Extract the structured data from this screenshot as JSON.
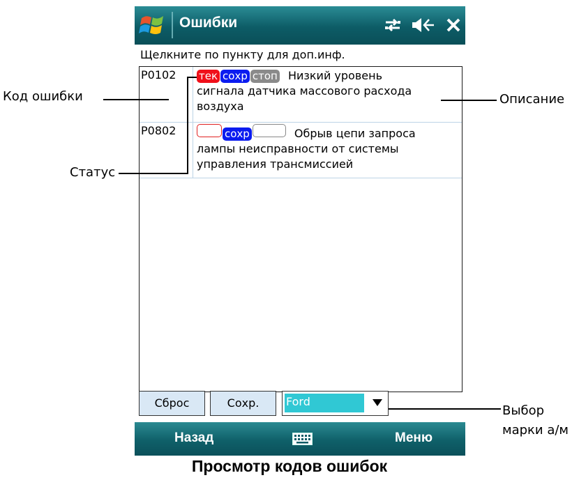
{
  "window": {
    "title": "Ошибки",
    "status_icons": [
      "sync-icon",
      "volume-icon",
      "close-icon"
    ]
  },
  "hint": "Щелкните по пункту для доп.инф.",
  "faults": [
    {
      "code": "P0102",
      "badges": [
        "тек",
        "сохр",
        "стоп"
      ],
      "description_lines": [
        "Низкий уровень",
        "сигнала датчика массового расхода",
        "воздуха"
      ]
    },
    {
      "code": "P0802",
      "badges": [
        "",
        "сохр",
        ""
      ],
      "description_lines": [
        "Обрыв цепи запроса",
        "лампы неисправности от системы",
        "управления трансмиссией"
      ]
    }
  ],
  "buttons": {
    "reset": "Сброс",
    "save": "Сохр."
  },
  "brand_select": {
    "value": "Ford"
  },
  "softkeys": {
    "left": "Назад",
    "right": "Меню"
  },
  "annotations": {
    "code": "Код ошибки",
    "description": "Описание",
    "status": "Статус",
    "brand_line1": "Выбор",
    "brand_line2": "марки а/м"
  },
  "caption": "Просмотр кодов ошибок",
  "colors": {
    "titlebar": "#0d5c66",
    "badge_current": "#f0101a",
    "badge_stored": "#0b1cf0",
    "badge_stop": "#8a8a8a",
    "select_highlight": "#30c8d4"
  }
}
